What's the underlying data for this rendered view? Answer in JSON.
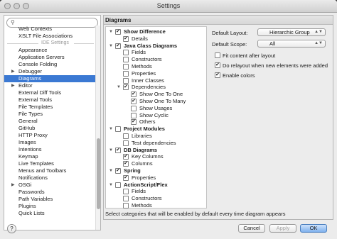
{
  "window": {
    "title": "Settings"
  },
  "search": {
    "value": ""
  },
  "tree": {
    "items": [
      {
        "label": "Web Contexts"
      },
      {
        "label": "XSLT File Associations"
      },
      {
        "label": "Appearance"
      },
      {
        "label": "Application Servers"
      },
      {
        "label": "Console Folding"
      },
      {
        "label": "Debugger"
      },
      {
        "label": "Diagrams"
      },
      {
        "label": "Editor"
      },
      {
        "label": "External Diff Tools"
      },
      {
        "label": "External Tools"
      },
      {
        "label": "File Templates"
      },
      {
        "label": "File Types"
      },
      {
        "label": "General"
      },
      {
        "label": "GitHub"
      },
      {
        "label": "HTTP Proxy"
      },
      {
        "label": "Images"
      },
      {
        "label": "Intentions"
      },
      {
        "label": "Keymap"
      },
      {
        "label": "Live Templates"
      },
      {
        "label": "Menus and Toolbars"
      },
      {
        "label": "Notifications"
      },
      {
        "label": "OSGi"
      },
      {
        "label": "Passwords"
      },
      {
        "label": "Path Variables"
      },
      {
        "label": "Plugins"
      },
      {
        "label": "Quick Lists"
      }
    ],
    "section_label": "IDE Settings",
    "selected": "Diagrams"
  },
  "panel": {
    "title": "Diagrams"
  },
  "categories": [
    {
      "label": "Show Difference",
      "checked": true,
      "bold": true
    },
    {
      "label": "Details",
      "checked": true,
      "bold": false
    },
    {
      "label": "Java Class Diagrams",
      "checked": true,
      "bold": true
    },
    {
      "label": "Fields",
      "checked": false,
      "bold": false
    },
    {
      "label": "Constructors",
      "checked": false,
      "bold": false
    },
    {
      "label": "Methods",
      "checked": false,
      "bold": false
    },
    {
      "label": "Properties",
      "checked": false,
      "bold": false
    },
    {
      "label": "Inner Classes",
      "checked": false,
      "bold": false
    },
    {
      "label": "Dependencies",
      "checked": true,
      "bold": false
    },
    {
      "label": "Show One To One",
      "checked": true,
      "bold": false
    },
    {
      "label": "Show One To Many",
      "checked": true,
      "bold": false
    },
    {
      "label": "Show Usages",
      "checked": false,
      "bold": false
    },
    {
      "label": "Show Cyclic",
      "checked": false,
      "bold": false
    },
    {
      "label": "Others",
      "checked": true,
      "bold": false
    },
    {
      "label": "Project Modules",
      "checked": false,
      "bold": true
    },
    {
      "label": "Libraries",
      "checked": false,
      "bold": false
    },
    {
      "label": "Test dependencies",
      "checked": false,
      "bold": false
    },
    {
      "label": "DB Diagrams",
      "checked": true,
      "bold": true
    },
    {
      "label": "Key Columns",
      "checked": true,
      "bold": false
    },
    {
      "label": "Columns",
      "checked": true,
      "bold": false
    },
    {
      "label": "Spring",
      "checked": true,
      "bold": true
    },
    {
      "label": "Properties",
      "checked": true,
      "bold": false
    },
    {
      "label": "ActionScript/Flex",
      "checked": false,
      "bold": true
    },
    {
      "label": "Fields",
      "checked": false,
      "bold": false
    },
    {
      "label": "Constructors",
      "checked": false,
      "bold": false
    },
    {
      "label": "Methods",
      "checked": false,
      "bold": false
    }
  ],
  "options": {
    "layout_label": "Default Layout:",
    "layout_value": "Hierarchic Group",
    "scope_label": "Default Scope:",
    "scope_value": "All",
    "fit_label": "Fit content after layout",
    "fit_checked": false,
    "relayout_label": "Do relayout when new elements were added",
    "relayout_checked": true,
    "colors_label": "Enable colors",
    "colors_checked": true
  },
  "status": "Select categories that will be enabled by default every time diagram appears",
  "buttons": {
    "help": "?",
    "cancel": "Cancel",
    "apply": "Apply",
    "ok": "OK"
  },
  "colors": {
    "selection": "#3b79d3",
    "ok_button": "#7fb2ee"
  }
}
